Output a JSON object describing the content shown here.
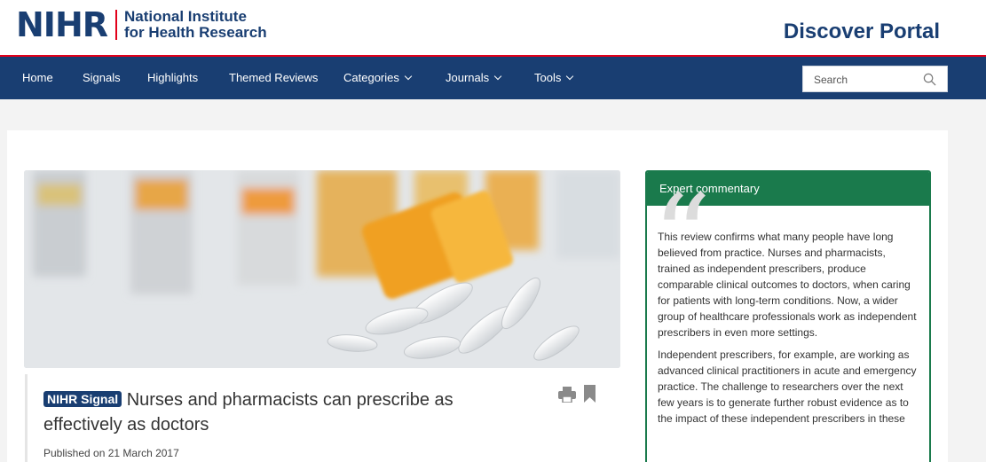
{
  "header": {
    "logo_mark": "NIHR",
    "logo_line1": "National Institute",
    "logo_line2": "for Health Research",
    "portal_title": "Discover Portal"
  },
  "nav": {
    "items": [
      {
        "label": "Home"
      },
      {
        "label": "Signals"
      },
      {
        "label": "Highlights"
      },
      {
        "label": "Themed Reviews"
      },
      {
        "label": "Categories"
      },
      {
        "label": "Journals"
      },
      {
        "label": "Tools"
      }
    ],
    "search_placeholder": "Search"
  },
  "article": {
    "badge": "NIHR Signal",
    "title": "Nurses and pharmacists can prescribe as effectively as doctors",
    "published": "Published on 21 March 2017"
  },
  "expert": {
    "heading": "Expert commentary",
    "paragraph1": "This review confirms what many people have long believed from practice. Nurses and pharmacists, trained as independent prescribers, produce comparable clinical outcomes to doctors, when caring for patients with long-term conditions. Now, a wider group of healthcare professionals work as independent prescribers in even more settings.",
    "paragraph2": "Independent prescribers, for example, are working as advanced clinical practitioners in acute and emergency practice. The challenge to researchers over the next few years is to generate further robust evidence as to the impact of these independent prescribers in these"
  },
  "colors": {
    "brand_navy": "#193e72",
    "accent_red": "#e2001a",
    "expert_green": "#1a7a4c"
  },
  "icons": [
    "search-icon",
    "print-icon",
    "bookmark-icon",
    "chevron-down-icon",
    "quote-icon"
  ]
}
